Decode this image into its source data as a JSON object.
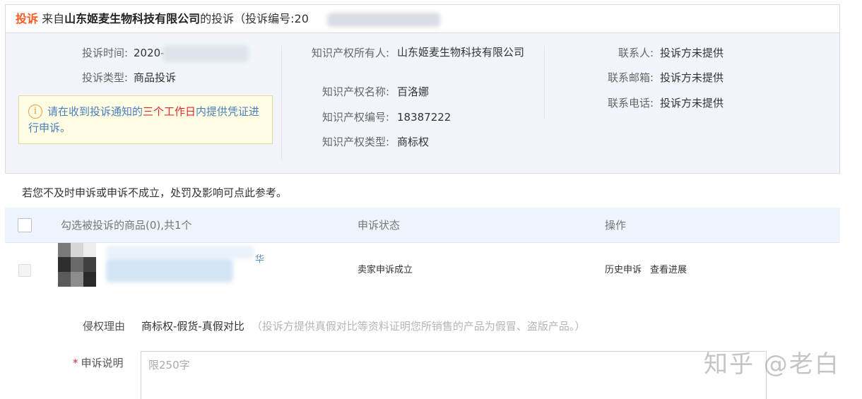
{
  "header": {
    "tag": "投诉",
    "from_prefix": "来自",
    "company": "山东姬麦生物科技有限公司",
    "suffix": "的投诉（投诉编号:20"
  },
  "details": {
    "complaint_time_label": "投诉时间:",
    "complaint_time_value": "2020-",
    "complaint_type_label": "投诉类型:",
    "complaint_type_value": "商品投诉",
    "ip_owner_label": "知识产权所有人:",
    "ip_owner_value": "山东姬麦生物科技有限公司",
    "ip_name_label": "知识产权名称:",
    "ip_name_value": "百洛娜",
    "ip_number_label": "知识产权编号:",
    "ip_number_value": "18387222",
    "ip_type_label": "知识产权类型:",
    "ip_type_value": "商标权",
    "contact_label": "联系人:",
    "contact_value": "投诉方未提供",
    "email_label": "联系邮箱:",
    "email_value": "投诉方未提供",
    "phone_label": "联系电话:",
    "phone_value": "投诉方未提供"
  },
  "notice": {
    "icon": "info-icon",
    "text_before": "请在收到投诉通知的",
    "highlight": "三个工作日",
    "text_after": "内提供凭证进行申诉。"
  },
  "reference_line": "若您不及时申诉或申诉不成立，处罚及影响可点此参考。",
  "table": {
    "columns": [
      "勾选被投诉的商品(0),共1个",
      "申诉状态",
      "操作"
    ],
    "rows": [
      {
        "title_visible": "华",
        "status": "卖家申诉成立",
        "actions": [
          "历史申诉",
          "查看进展"
        ]
      }
    ]
  },
  "form": {
    "reason_label": "侵权理由",
    "reason_value": "商标权-假货-真假对比",
    "reason_note": "（投诉方提供真假对比等资料证明您所销售的产品为假冒、盗版产品。）",
    "required_mark": "*",
    "explanation_label": "申诉说明",
    "explanation_placeholder": "限250字"
  },
  "watermark": "知乎 @老白",
  "colors": {
    "accent_orange": "#ff5a1f",
    "link_blue": "#4a7fbd",
    "highlight_red": "#e0262d",
    "panel_bg": "#f1f5fb",
    "notice_bg": "#fffde3"
  }
}
